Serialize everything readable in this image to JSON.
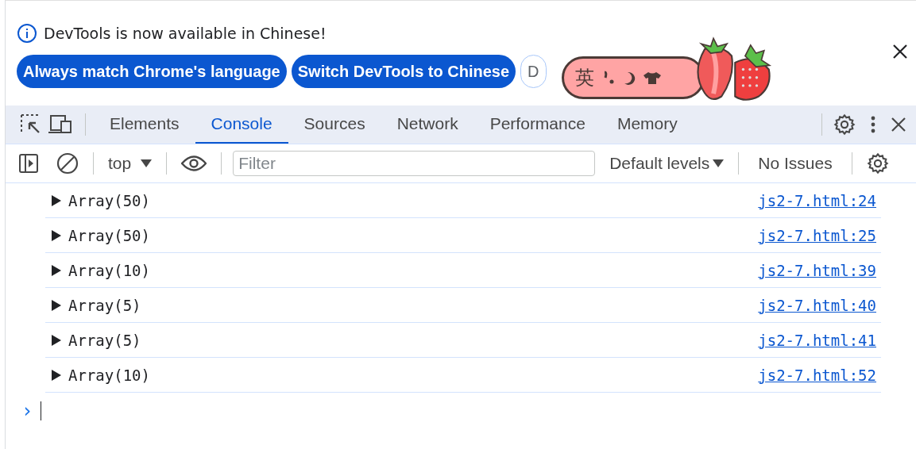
{
  "infobar": {
    "message": "DevTools is now available in Chinese!",
    "buttons": [
      {
        "label": "Always match Chrome's language",
        "kind": "primary"
      },
      {
        "label": "Switch DevTools to Chinese",
        "kind": "primary"
      },
      {
        "label": "D",
        "kind": "outline"
      }
    ]
  },
  "tabs": [
    {
      "label": "Elements",
      "selected": false
    },
    {
      "label": "Console",
      "selected": true
    },
    {
      "label": "Sources",
      "selected": false
    },
    {
      "label": "Network",
      "selected": false
    },
    {
      "label": "Performance",
      "selected": false
    },
    {
      "label": "Memory",
      "selected": false
    }
  ],
  "toolbar": {
    "context": "top",
    "filter": {
      "placeholder": "Filter"
    },
    "levels": "Default levels",
    "issues": "No Issues"
  },
  "messages": [
    {
      "text": "Array(50)",
      "source": "js2-7.html:24"
    },
    {
      "text": "Array(50)",
      "source": "js2-7.html:25"
    },
    {
      "text": "Array(10)",
      "source": "js2-7.html:39"
    },
    {
      "text": "Array(5)",
      "source": "js2-7.html:40"
    },
    {
      "text": "Array(5)",
      "source": "js2-7.html:41"
    },
    {
      "text": "Array(10)",
      "source": "js2-7.html:52"
    }
  ],
  "prompt": "›",
  "ime": {
    "mode": "英"
  }
}
